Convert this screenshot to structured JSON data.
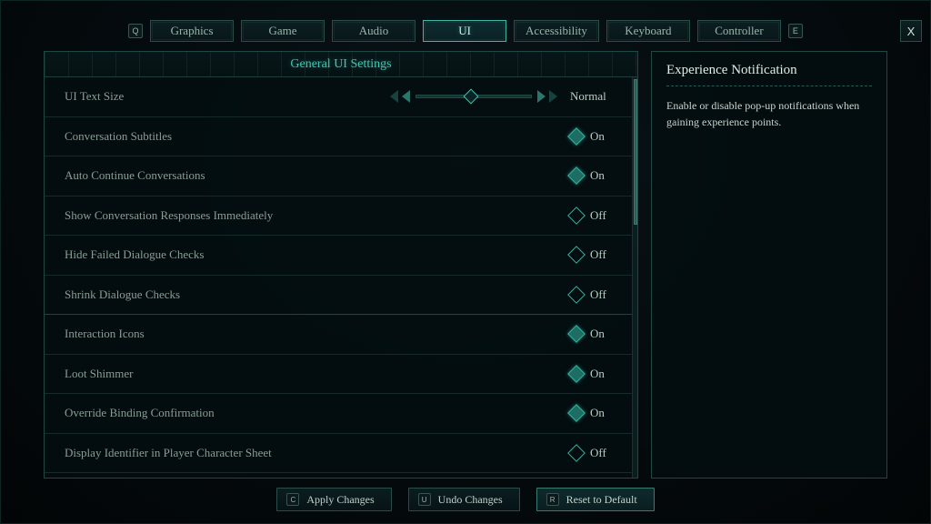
{
  "tabs": {
    "prev_key": "Q",
    "next_key": "E",
    "close": "X",
    "items": [
      "Graphics",
      "Game",
      "Audio",
      "UI",
      "Accessibility",
      "Keyboard",
      "Controller"
    ],
    "active_index": 3
  },
  "group_title": "General UI Settings",
  "settings": [
    {
      "label": "UI Text Size",
      "type": "slider",
      "value_text": "Normal"
    },
    {
      "label": "Conversation Subtitles",
      "type": "toggle",
      "value_text": "On",
      "on": true
    },
    {
      "label": "Auto Continue Conversations",
      "type": "toggle",
      "value_text": "On",
      "on": true
    },
    {
      "label": "Show Conversation Responses Immediately",
      "type": "toggle",
      "value_text": "Off",
      "on": false
    },
    {
      "label": "Hide Failed Dialogue Checks",
      "type": "toggle",
      "value_text": "Off",
      "on": false
    },
    {
      "label": "Shrink Dialogue Checks",
      "type": "toggle",
      "value_text": "Off",
      "on": false,
      "divider_after": true
    },
    {
      "label": "Interaction Icons",
      "type": "toggle",
      "value_text": "On",
      "on": true
    },
    {
      "label": "Loot Shimmer",
      "type": "toggle",
      "value_text": "On",
      "on": true
    },
    {
      "label": "Override Binding Confirmation",
      "type": "toggle",
      "value_text": "On",
      "on": true
    },
    {
      "label": "Display Identifier in Player Character Sheet",
      "type": "toggle",
      "value_text": "Off",
      "on": false
    }
  ],
  "info": {
    "title": "Experience Notification",
    "body": "Enable or disable pop-up notifications when gaining experience points."
  },
  "bottom": {
    "apply": {
      "key": "C",
      "label": "Apply Changes"
    },
    "undo": {
      "key": "U",
      "label": "Undo Changes"
    },
    "reset": {
      "key": "R",
      "label": "Reset to Default"
    }
  }
}
